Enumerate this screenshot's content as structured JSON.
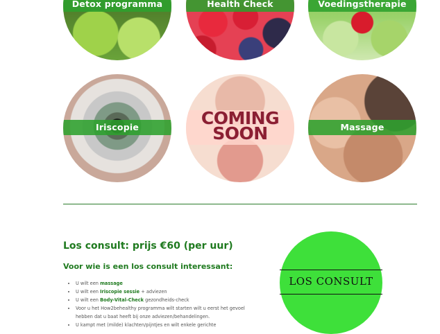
{
  "services": {
    "top": [
      {
        "label": "Detox programma"
      },
      {
        "label": "Health Check"
      },
      {
        "label": "Voedingstherapie"
      }
    ],
    "middle": [
      {
        "label": "Iriscopie"
      },
      {
        "line1": "COMING",
        "line2": "SOON"
      },
      {
        "label": "Massage"
      }
    ]
  },
  "consult": {
    "title": "Los consult: prijs €60 (per uur)",
    "subtitle": "Voor wie is een los consult interessant:",
    "items": [
      {
        "pre": "U wilt een ",
        "bold": "massage",
        "post": ""
      },
      {
        "pre": "U wilt een ",
        "bold": "Iriscopie sessie",
        "post": " + adviezen"
      },
      {
        "pre": "U wilt een ",
        "bold": "Body-Vital-Check",
        "post": " gezondheids-check"
      },
      {
        "pre": "Voor u het How2behealthy programma wilt starten wilt u eerst het gevoel hebben dat u baat heeft bij onze adviezen/behandelingen.",
        "bold": "",
        "post": ""
      },
      {
        "pre": "U kampt met (milde) klachten/pijntjes en wilt enkele gerichte",
        "bold": "",
        "post": ""
      }
    ]
  },
  "badge": {
    "label": "LOS CONSULT"
  },
  "colors": {
    "accent": "#1f7a1f",
    "band": "#2ea02e",
    "badge": "#3ee03a"
  }
}
